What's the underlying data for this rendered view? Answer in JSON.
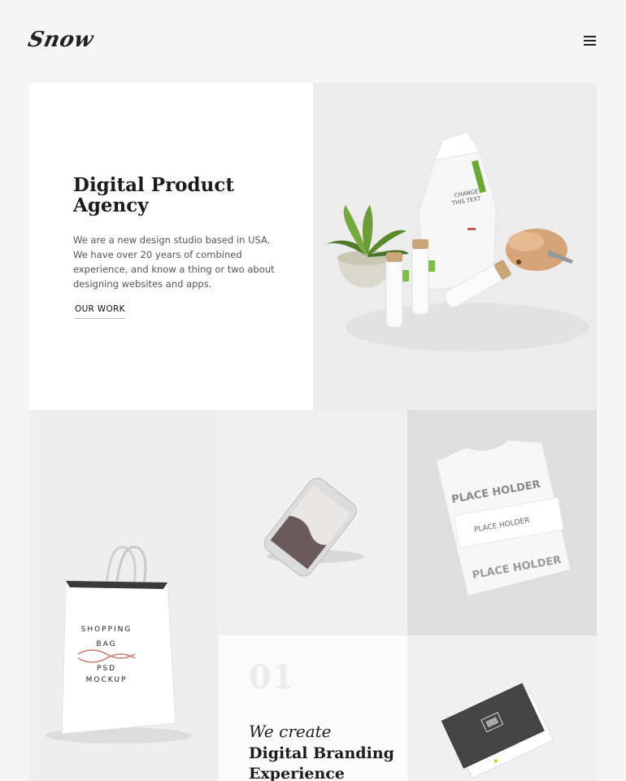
{
  "header": {
    "logo": "Snow",
    "menu_icon": "hamburger-menu-icon"
  },
  "hero": {
    "title": "Digital Product Agency",
    "description": "We are a new design studio based in USA. We have over 20 years of combined experience, and know a thing or two about designing websites and apps.",
    "link": "OUR WORK"
  },
  "mockups": {
    "package_label": "CHANGE THIS TEXT",
    "bag_text": [
      "SHOPPING",
      "BAG",
      "PSD",
      "MOCKUP"
    ],
    "shirt_text": "PLACE HOLDER"
  },
  "service": {
    "number": "01",
    "subtitle": "We create",
    "title": "Digital Branding Experience"
  }
}
